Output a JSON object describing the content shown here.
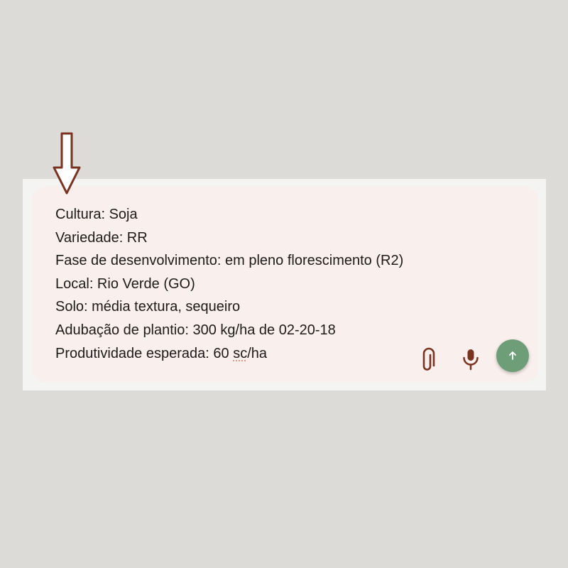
{
  "prompt": {
    "lines": [
      "Cultura: Soja",
      "Variedade: RR",
      "Fase de desenvolvimento: em pleno florescimento (R2)",
      "Local: Rio Verde (GO)",
      "Solo: média textura, sequeiro",
      "Adubação de plantio: 300 kg/ha de 02-20-18"
    ],
    "last_line": {
      "before": "Produtividade esperada: 60 ",
      "flagged_word": "sc",
      "after": "/ha"
    }
  },
  "icons": {
    "pointer": "arrow-down-icon",
    "attach": "paperclip-icon",
    "voice": "microphone-icon",
    "send": "arrow-up-icon"
  },
  "colors": {
    "background": "#dcdbd7",
    "card": "#f9efec",
    "icon": "#7a3320",
    "send_button": "#6e9e78",
    "arrow_outline": "#7a3320"
  }
}
